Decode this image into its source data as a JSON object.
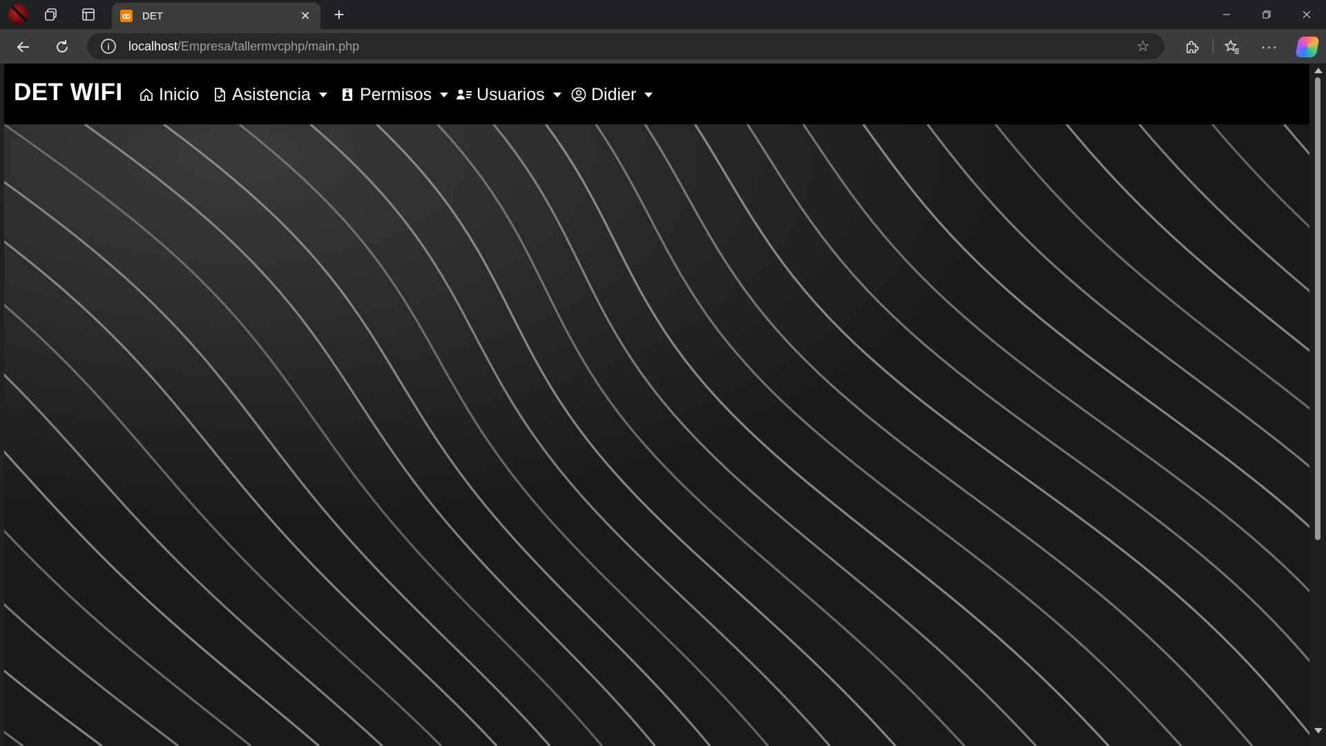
{
  "browser": {
    "tab": {
      "title": "DET",
      "favicon": "xampp-favicon-icon"
    },
    "address": {
      "host": "localhost",
      "path": "/Empresa/tallermvcphp/main.php"
    }
  },
  "page": {
    "brand": "DET WIFI",
    "nav": [
      {
        "label": "Inicio",
        "icon": "home-icon",
        "dropdown": false
      },
      {
        "label": "Asistencia",
        "icon": "file-check-icon",
        "dropdown": true
      },
      {
        "label": "Permisos",
        "icon": "id-badge-icon",
        "dropdown": true
      },
      {
        "label": "Usuarios",
        "icon": "users-list-icon",
        "dropdown": true
      },
      {
        "label": "Didier",
        "icon": "user-circle-icon",
        "dropdown": true
      }
    ],
    "hero": {
      "background": "abstract diagonal wavy lines, black and white"
    }
  },
  "colors": {
    "navbar_bg": "#000000",
    "nav_text": "#ffffff",
    "hero_bg": "#1b1b1b",
    "line_color": "#9a9a9a",
    "chrome_bg": "#202124",
    "toolbar_bg": "#3c3c3c"
  }
}
